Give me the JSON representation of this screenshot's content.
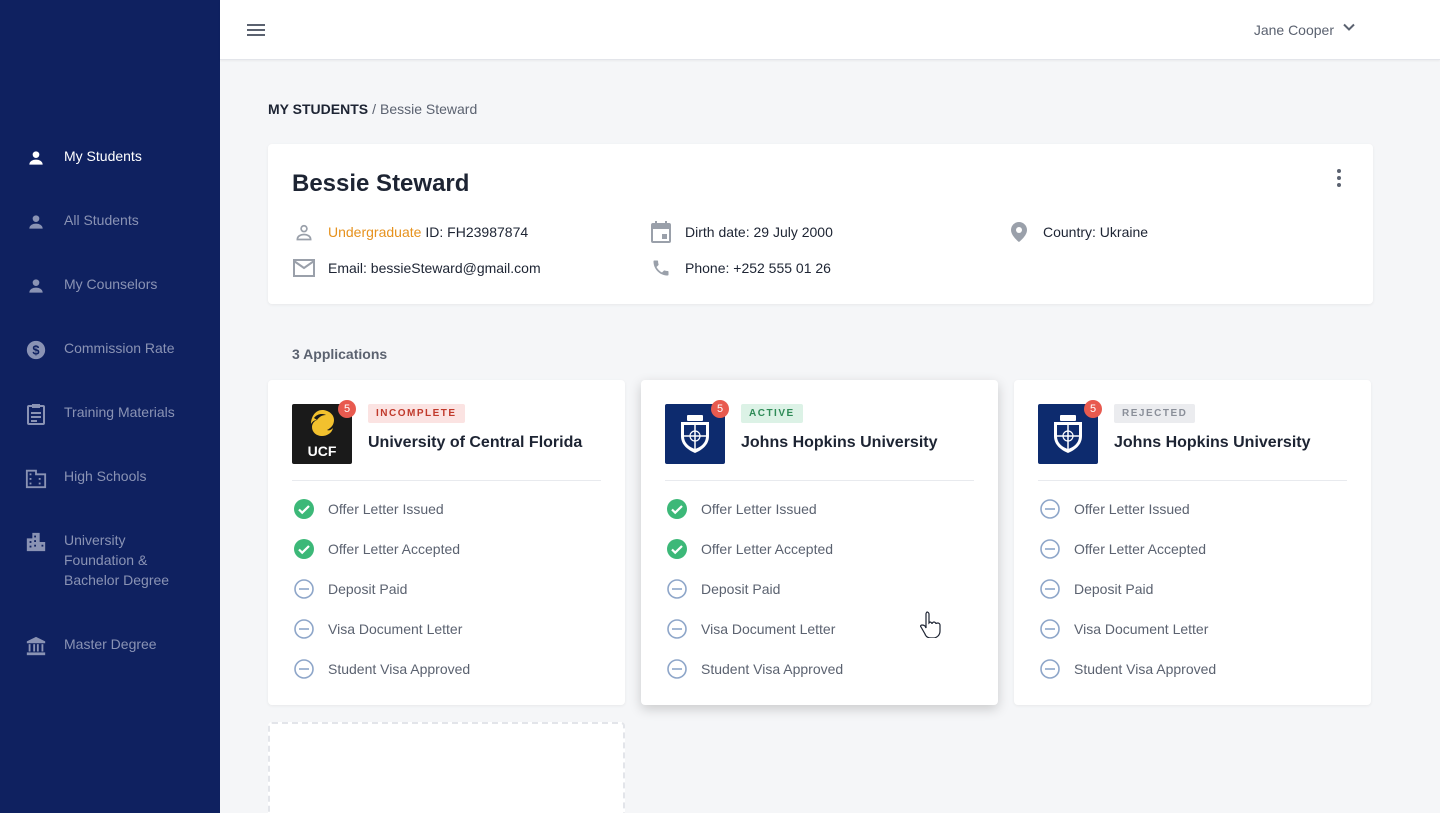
{
  "sidebar": {
    "items": [
      {
        "label": "My Students",
        "icon": "person-icon",
        "active": true
      },
      {
        "label": "All Students",
        "icon": "person-icon",
        "active": false
      },
      {
        "label": "My Counselors",
        "icon": "person-icon",
        "active": false
      },
      {
        "label": "Commission Rate",
        "icon": "dollar-circle-icon",
        "active": false
      },
      {
        "label": "Training Materials",
        "icon": "clipboard-icon",
        "active": false
      },
      {
        "label": "High Schools",
        "icon": "building-icon",
        "active": false
      },
      {
        "label": "University Foundation & Bachelor Degree",
        "icon": "city-building-icon",
        "active": false
      },
      {
        "label": "Master Degree",
        "icon": "bank-icon",
        "active": false
      }
    ]
  },
  "header": {
    "user_name": "Jane Cooper"
  },
  "breadcrumb": {
    "root": "MY STUDENTS",
    "separator": "/",
    "current": "Bessie Steward"
  },
  "student": {
    "name": "Bessie Steward",
    "level": "Undergraduate",
    "id_text": "ID: FH23987874",
    "email": "Email: bessieSteward@gmail.com",
    "birth": "Dirth date: 29 July 2000",
    "phone": "Phone: +252 555 01 26",
    "country": "Country: Ukraine"
  },
  "applications": {
    "count_label": "3 Applications",
    "cards": [
      {
        "university": "University of Central Florida",
        "logo": "UCF",
        "notifications": "5",
        "status": "INCOMPLETE",
        "steps": [
          {
            "label": "Offer Letter Issued",
            "done": true
          },
          {
            "label": "Offer Letter Accepted",
            "done": true
          },
          {
            "label": "Deposit Paid",
            "done": false
          },
          {
            "label": "Visa Document Letter",
            "done": false
          },
          {
            "label": "Student Visa Approved",
            "done": false
          }
        ]
      },
      {
        "university": "Johns Hopkins University",
        "logo": "jhu-shield",
        "notifications": "5",
        "status": "ACTIVE",
        "steps": [
          {
            "label": "Offer Letter Issued",
            "done": true
          },
          {
            "label": "Offer Letter Accepted",
            "done": true
          },
          {
            "label": "Deposit Paid",
            "done": false
          },
          {
            "label": "Visa Document Letter",
            "done": false
          },
          {
            "label": "Student Visa Approved",
            "done": false
          }
        ]
      },
      {
        "university": "Johns Hopkins University",
        "logo": "jhu-shield",
        "notifications": "5",
        "status": "REJECTED",
        "steps": [
          {
            "label": "Offer Letter Issued",
            "done": false
          },
          {
            "label": "Offer Letter Accepted",
            "done": false
          },
          {
            "label": "Deposit Paid",
            "done": false
          },
          {
            "label": "Visa Document Letter",
            "done": false
          },
          {
            "label": "Student Visa Approved",
            "done": false
          }
        ]
      }
    ]
  },
  "colors": {
    "sidebar_bg": "#0f2160",
    "accent": "#e6921e",
    "done_green": "#3cb878",
    "pending_blue": "#8ea6c9",
    "badge_red": "#e85a4f"
  }
}
